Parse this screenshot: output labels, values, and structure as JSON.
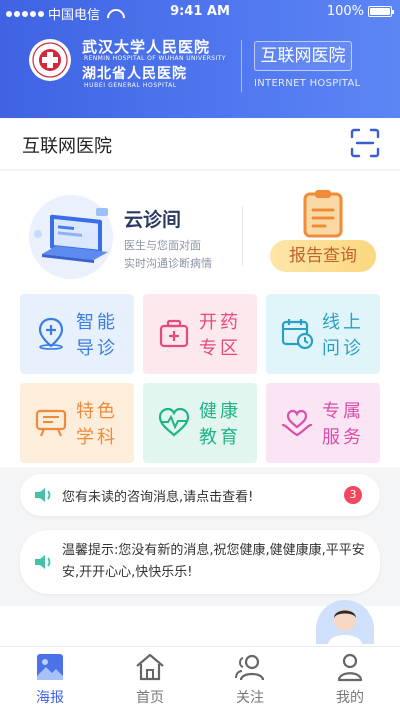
{
  "status_bar": {
    "carrier": "中国电信",
    "time": "9:41 AM",
    "battery": "100%"
  },
  "hospital": {
    "name_cn_1": "武汉大学人民医院",
    "name_en_1": "RENMIN HOSPITAL OF WUHAN UNIVERSITY",
    "name_cn_2": "湖北省人民医院",
    "name_en_2": "HUBEI     GENERAL     HOSPITAL",
    "internet_cn": "互联网医院",
    "internet_en": "INTERNET HOSPITAL"
  },
  "titlebar": {
    "title": "互联网医院",
    "scan_icon": "scan-icon"
  },
  "cloud_clinic": {
    "title": "云诊间",
    "subtitle_1": "医生与您面对面",
    "subtitle_2": "实时沟通诊断病情"
  },
  "report": {
    "label": "报告查询"
  },
  "tiles": [
    {
      "line1": "智能",
      "line2": "导诊",
      "icon": "location-plus-icon",
      "bg": "#e7f1fd",
      "fg": "#3b7de0"
    },
    {
      "line1": "开药",
      "line2": "专区",
      "icon": "medicine-box-icon",
      "bg": "#fde8ee",
      "fg": "#e8497a"
    },
    {
      "line1": "线上",
      "line2": "问诊",
      "icon": "calendar-clock-icon",
      "bg": "#e0f5fa",
      "fg": "#2a9fc4"
    },
    {
      "line1": "特色",
      "line2": "学科",
      "icon": "presentation-board-icon",
      "bg": "#fdeedb",
      "fg": "#ef8a3a"
    },
    {
      "line1": "健康",
      "line2": "教育",
      "icon": "heart-pulse-icon",
      "bg": "#e2f6ef",
      "fg": "#20b38a"
    },
    {
      "line1": "专属",
      "line2": "服务",
      "icon": "heart-hand-icon",
      "bg": "#fbe4f4",
      "fg": "#d94faa"
    }
  ],
  "notices": {
    "unread": "您有未读的咨询消息,请点击查看!",
    "unread_count": "3",
    "tip": "温馨提示:您没有新的消息,祝您健康,健健康康,平平安安,开开心心,快快乐乐!"
  },
  "tabs": [
    {
      "label": "海报",
      "icon": "poster-image-icon",
      "active": true
    },
    {
      "label": "首页",
      "icon": "home-icon",
      "active": false
    },
    {
      "label": "关注",
      "icon": "follow-users-icon",
      "active": false
    },
    {
      "label": "我的",
      "icon": "profile-icon",
      "active": false
    }
  ],
  "colors": {
    "primary": "#4369e6",
    "accent_orange": "#f3a33a",
    "badge_red": "#f2485d"
  }
}
